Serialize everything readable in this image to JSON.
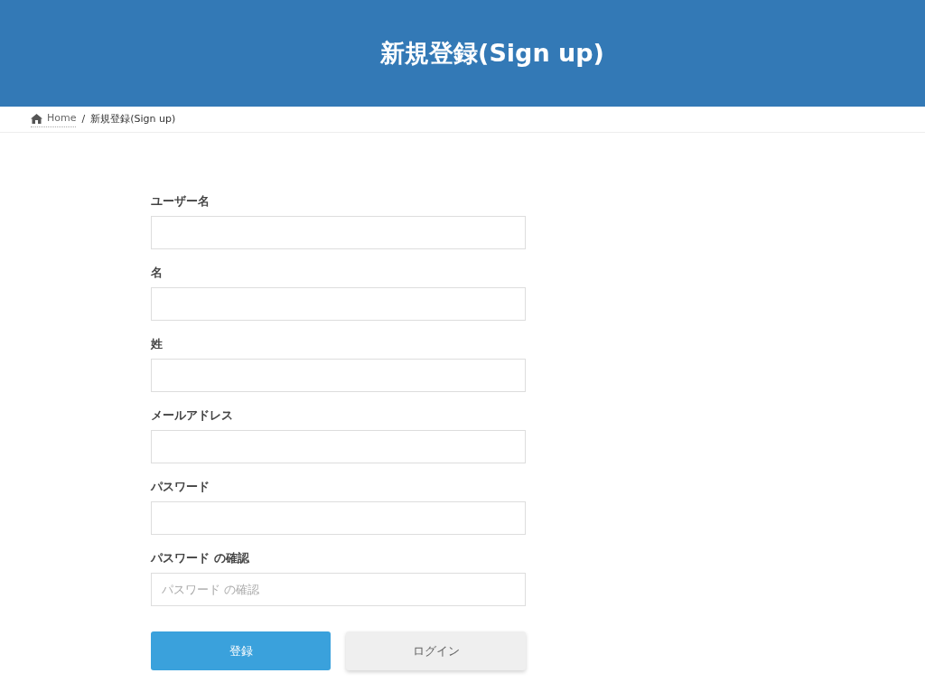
{
  "header": {
    "title": "新規登録(Sign up)"
  },
  "breadcrumb": [
    {
      "label": "Home",
      "kind": "link"
    },
    {
      "label": "新規登録(Sign up)",
      "kind": "current"
    }
  ],
  "breadcrumb_separator": "/",
  "fields": [
    {
      "label": "ユーザー名"
    },
    {
      "label": "名"
    },
    {
      "label": "姓"
    },
    {
      "label": "メールアドレス"
    },
    {
      "label": "パスワード"
    },
    {
      "label": "パスワード の確認",
      "placeholder": "パスワード の確認"
    }
  ],
  "buttons": [
    {
      "label": "登録",
      "kind": "primary"
    },
    {
      "label": "ログイン",
      "kind": "secondary"
    }
  ]
}
